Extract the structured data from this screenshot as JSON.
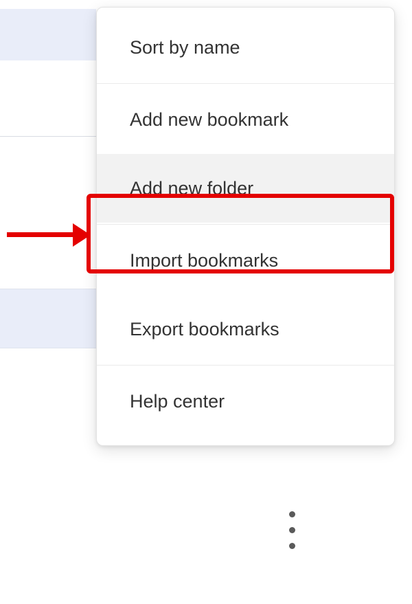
{
  "menu": {
    "sort_by_name": "Sort by name",
    "add_new_bookmark": "Add new bookmark",
    "add_new_folder": "Add new folder",
    "import_bookmarks": "Import bookmarks",
    "export_bookmarks": "Export bookmarks",
    "help_center": "Help center"
  },
  "annotation": {
    "highlighted_item": "add_new_folder",
    "highlight_color": "#e40000"
  }
}
